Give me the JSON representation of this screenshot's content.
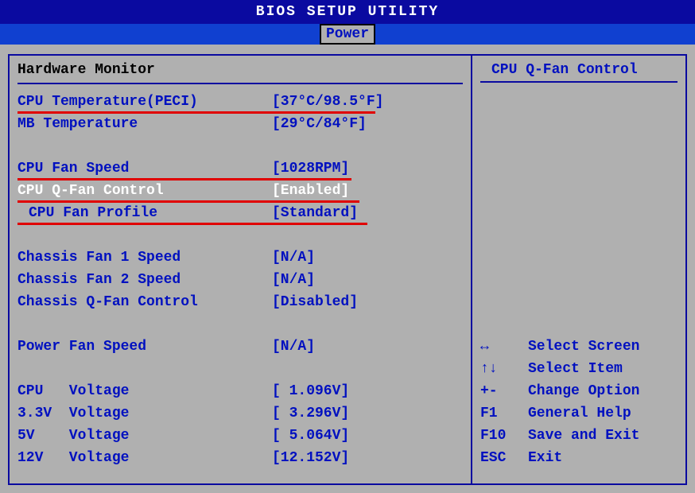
{
  "title": "BIOS SETUP UTILITY",
  "active_tab": "Power",
  "section_title": "Hardware Monitor",
  "help_title": "CPU Q-Fan Control",
  "rows": {
    "cpu_temp_label": "CPU Temperature(PECI)",
    "cpu_temp_value": "[37°C/98.5°F]",
    "mb_temp_label": "MB Temperature",
    "mb_temp_value": "[29°C/84°F]",
    "cpu_fan_speed_label": "CPU Fan Speed",
    "cpu_fan_speed_value": "[1028RPM]",
    "cpu_qfan_label": "CPU Q-Fan Control",
    "cpu_qfan_value": "[Enabled]",
    "cpu_fan_profile_label": "CPU Fan Profile",
    "cpu_fan_profile_value": "[Standard]",
    "chassis1_label": "Chassis Fan 1 Speed",
    "chassis1_value": "[N/A]",
    "chassis2_label": "Chassis Fan 2 Speed",
    "chassis2_value": "[N/A]",
    "chassis_qfan_label": "Chassis Q-Fan Control",
    "chassis_qfan_value": "[Disabled]",
    "power_fan_label": "Power Fan Speed",
    "power_fan_value": "[N/A]",
    "cpu_v_label": "CPU   Voltage",
    "cpu_v_value": "[ 1.096V]",
    "v33_label": "3.3V  Voltage",
    "v33_value": "[ 3.296V]",
    "v5_label": "5V    Voltage",
    "v5_value": "[ 5.064V]",
    "v12_label": "12V   Voltage",
    "v12_value": "[12.152V]"
  },
  "keys": {
    "k1": "↔",
    "d1": "Select Screen",
    "k2": "↑↓",
    "d2": "Select Item",
    "k3": "+-",
    "d3": "Change Option",
    "k4": "F1",
    "d4": "General Help",
    "k5": "F10",
    "d5": "Save and Exit",
    "k6": "ESC",
    "d6": "Exit"
  }
}
